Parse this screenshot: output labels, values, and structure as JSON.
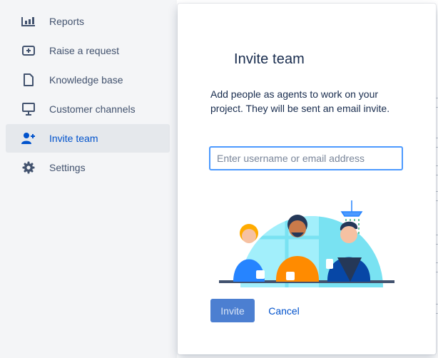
{
  "sidebar": {
    "items": [
      {
        "label": "Reports",
        "icon": "reports-chart-icon",
        "active": false
      },
      {
        "label": "Raise a request",
        "icon": "raise-request-icon",
        "active": false
      },
      {
        "label": "Knowledge base",
        "icon": "document-icon",
        "active": false
      },
      {
        "label": "Customer channels",
        "icon": "monitor-icon",
        "active": false
      },
      {
        "label": "Invite team",
        "icon": "add-person-icon",
        "active": true
      },
      {
        "label": "Settings",
        "icon": "gear-icon",
        "active": false
      }
    ]
  },
  "modal": {
    "title": "Invite team",
    "description": "Add people as agents to work on your project. They will be sent an email invite.",
    "input": {
      "placeholder": "Enter username or email address",
      "value": ""
    },
    "invite_label": "Invite",
    "cancel_label": "Cancel"
  },
  "colors": {
    "accent": "#0052cc",
    "sidebar_bg": "#f4f5f7",
    "active_bg": "#e5e8ec",
    "input_focus": "#4c9aff",
    "primary_disabled": "#4c7fd1"
  }
}
